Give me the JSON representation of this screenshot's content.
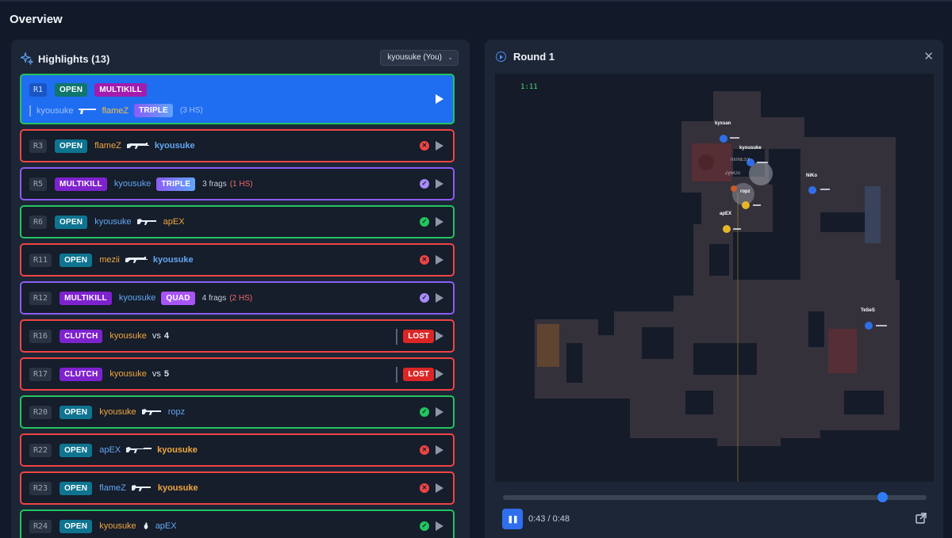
{
  "page": {
    "title": "Overview"
  },
  "highlights": {
    "title": "Highlights (13)",
    "player_filter": "kyousuke (You)",
    "rows": [
      {
        "round": "R1",
        "badges": [
          "OPEN",
          "MULTIKILL"
        ],
        "killer": "kyousuke",
        "victim": "flameZ",
        "tag": "TRIPLE",
        "hs": "(3 HS)",
        "border": "green",
        "active": true
      },
      {
        "round": "R3",
        "badge": "OPEN",
        "killer": "flameZ",
        "victim": "kyousuke",
        "result": "loss",
        "border": "red"
      },
      {
        "round": "R5",
        "badge": "MULTIKILL",
        "killer": "kyousuke",
        "tag": "TRIPLE",
        "frags": "3 frags",
        "hs": "(1 HS)",
        "result": "multi",
        "border": "purple"
      },
      {
        "round": "R6",
        "badge": "OPEN",
        "killer": "kyousuke",
        "victim": "apEX",
        "result": "win",
        "border": "green"
      },
      {
        "round": "R11",
        "badge": "OPEN",
        "killer": "mezii",
        "victim": "kyousuke",
        "result": "loss",
        "border": "red"
      },
      {
        "round": "R12",
        "badge": "MULTIKILL",
        "killer": "kyousuke",
        "tag": "QUAD",
        "frags": "4 frags",
        "hs": "(2 HS)",
        "result": "multi",
        "border": "purple"
      },
      {
        "round": "R16",
        "badge": "CLUTCH",
        "killer": "kyousuke",
        "vs": "vs",
        "vs_count": "4",
        "outcome": "LOST",
        "border": "red"
      },
      {
        "round": "R17",
        "badge": "CLUTCH",
        "killer": "kyousuke",
        "vs": "vs",
        "vs_count": "5",
        "outcome": "LOST",
        "border": "red"
      },
      {
        "round": "R20",
        "badge": "OPEN",
        "killer": "kyousuke",
        "victim": "ropz",
        "result": "win",
        "border": "green"
      },
      {
        "round": "R22",
        "badge": "OPEN",
        "killer": "apEX",
        "victim": "kyousuke",
        "result": "loss",
        "border": "red"
      },
      {
        "round": "R23",
        "badge": "OPEN",
        "killer": "flameZ",
        "victim": "kyousuke",
        "result": "loss",
        "border": "red"
      },
      {
        "round": "R24",
        "badge": "OPEN",
        "killer": "kyousuke",
        "victim": "apEX",
        "result": "win",
        "border": "green"
      }
    ]
  },
  "round": {
    "title": "Round 1",
    "timer": "1:11",
    "players": [
      "kyxsan",
      "kyousuke",
      "m0NESY",
      "ZywOo",
      "ropz",
      "apEX",
      "NiKo",
      "TeSeS"
    ],
    "player_icons": {
      "ct": "#2f6fe6",
      "t": "#e6b62a"
    },
    "playback": {
      "time": "0:43 / 0:48",
      "progress": 0.896
    }
  },
  "colors": {
    "accent": "#2f7cf6",
    "win": "#22c55e",
    "loss": "#ef4444",
    "multi": "#8b5cf6"
  }
}
